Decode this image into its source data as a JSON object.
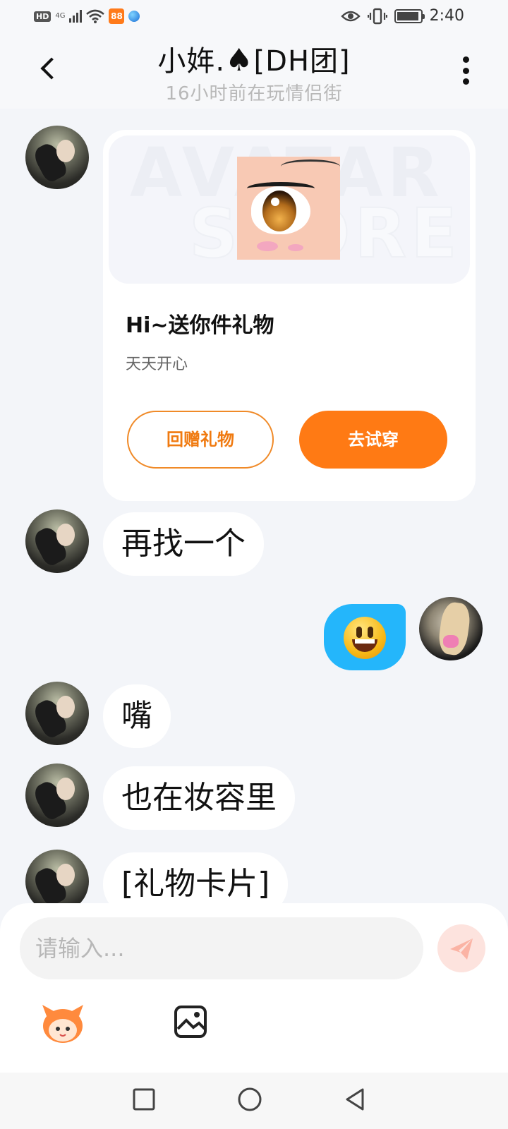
{
  "status_bar": {
    "hd": "HD",
    "network": "4G",
    "time": "2:40",
    "battery_level": 0.85,
    "app_badge": "88"
  },
  "header": {
    "title_prefix": "小姩.",
    "title_suffix": "[DH团]",
    "title_symbol": "♠",
    "subtitle": "16小时前在玩情侣街"
  },
  "gift_card": {
    "watermark_line1": "AVATAR",
    "watermark_line2": "STORE",
    "title": "Hi~送你件礼物",
    "subtitle": "天天开心",
    "return_label": "回赠礼物",
    "try_label": "去试穿"
  },
  "messages": [
    {
      "from": "other",
      "text": "再找一个"
    },
    {
      "from": "me",
      "type": "emoji",
      "icon": "grinning-face"
    },
    {
      "from": "other",
      "text": "嘴"
    },
    {
      "from": "other",
      "text": "也在妆容里"
    },
    {
      "from": "other",
      "text": "[礼物卡片]"
    }
  ],
  "composer": {
    "placeholder": "请输入...",
    "send_icon": "paper-plane-icon",
    "tools": [
      "mascot-sticker-icon",
      "image-icon"
    ]
  },
  "nav": [
    "square-icon",
    "circle-icon",
    "triangle-back-icon"
  ],
  "colors": {
    "accent": "#ff7a14",
    "emoji_bubble": "#24b6fb",
    "background": "#f3f5f9"
  }
}
